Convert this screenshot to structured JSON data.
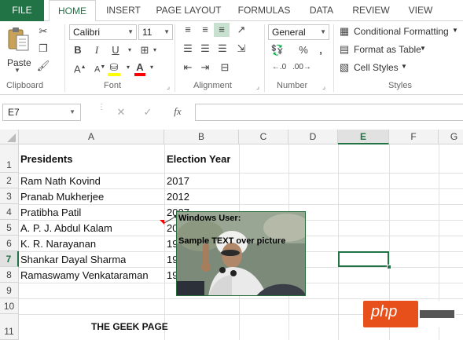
{
  "ribbon_tabs": [
    "FILE",
    "HOME",
    "INSERT",
    "PAGE LAYOUT",
    "FORMULAS",
    "DATA",
    "REVIEW",
    "VIEW"
  ],
  "ribbon": {
    "clipboard": {
      "paste_label": "Paste",
      "group_label": "Clipboard"
    },
    "font": {
      "name": "Calibri",
      "size": "11",
      "group_label": "Font",
      "fill_color": "#ffff00",
      "font_color": "#ff0000"
    },
    "alignment": {
      "group_label": "Alignment"
    },
    "number": {
      "format": "General",
      "group_label": "Number"
    },
    "styles": {
      "conditional_formatting": "Conditional Formatting",
      "format_as_table": "Format as Table",
      "cell_styles": "Cell Styles",
      "group_label": "Styles"
    }
  },
  "formula_bar": {
    "name_box": "E7",
    "formula": ""
  },
  "columns": [
    "A",
    "B",
    "C",
    "D",
    "E",
    "F",
    "G"
  ],
  "rows": [
    "1",
    "2",
    "3",
    "4",
    "5",
    "6",
    "7",
    "8",
    "9",
    "10",
    "11"
  ],
  "table": {
    "headers": [
      "Presidents",
      "Election Year"
    ],
    "rows": [
      [
        "Ram Nath Kovind",
        "2017"
      ],
      [
        "Pranab Mukherjee",
        "2012"
      ],
      [
        "Pratibha Patil",
        "2007"
      ],
      [
        "A. P. J. Abdul Kalam",
        "20"
      ],
      [
        "K. R. Narayanan",
        "19"
      ],
      [
        "Shankar Dayal Sharma",
        "19"
      ],
      [
        "Ramaswamy Venkataraman",
        "19"
      ]
    ]
  },
  "footer_text": "THE GEEK PAGE",
  "comment": {
    "author": "Windows User:",
    "text": "Sample TEXT over picture"
  },
  "watermark": "php",
  "colors": {
    "accent": "#217346",
    "comment_indicator": "#ff0000"
  }
}
